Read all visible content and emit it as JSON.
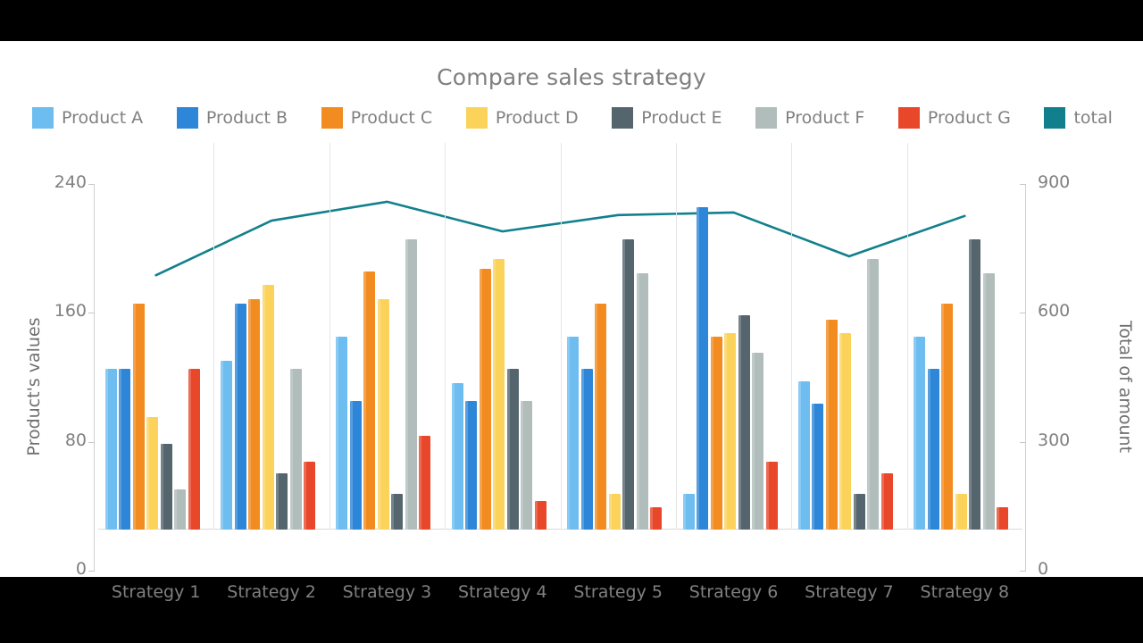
{
  "chart_data": {
    "type": "bar",
    "title": "Compare sales strategy",
    "xlabel": "",
    "ylabel": "Product's values",
    "y2label": "Total of amount",
    "categories": [
      "Strategy 1",
      "Strategy 2",
      "Strategy 3",
      "Strategy 4",
      "Strategy 5",
      "Strategy 6",
      "Strategy 7",
      "Strategy 8"
    ],
    "ylim": [
      0,
      240
    ],
    "yticks": [
      0,
      80,
      160,
      240
    ],
    "y2lim": [
      0,
      900
    ],
    "y2ticks": [
      0,
      300,
      600,
      900
    ],
    "grid": true,
    "legend_position": "top",
    "series": [
      {
        "name": "Product A",
        "type": "bar",
        "axis": "left",
        "color": "#6DBDF0",
        "values": [
          100,
          105,
          120,
          91,
          120,
          22,
          92,
          120
        ]
      },
      {
        "name": "Product B",
        "type": "bar",
        "axis": "left",
        "color": "#2E86D8",
        "values": [
          100,
          140,
          80,
          80,
          100,
          200,
          78,
          100
        ]
      },
      {
        "name": "Product C",
        "type": "bar",
        "axis": "left",
        "color": "#F28B20",
        "values": [
          140,
          143,
          160,
          162,
          140,
          120,
          130,
          140
        ]
      },
      {
        "name": "Product D",
        "type": "bar",
        "axis": "left",
        "color": "#FBD35B",
        "values": [
          70,
          152,
          143,
          168,
          22,
          122,
          122,
          22
        ]
      },
      {
        "name": "Product E",
        "type": "bar",
        "axis": "left",
        "color": "#55656E",
        "values": [
          53,
          35,
          22,
          100,
          180,
          133,
          22,
          180
        ]
      },
      {
        "name": "Product F",
        "type": "bar",
        "axis": "left",
        "color": "#B0BDBB",
        "values": [
          25,
          100,
          180,
          80,
          159,
          110,
          168,
          159
        ]
      },
      {
        "name": "Product G",
        "type": "bar",
        "axis": "left",
        "color": "#E8472A",
        "values": [
          100,
          42,
          58,
          18,
          14,
          42,
          35,
          14
        ]
      },
      {
        "name": "total",
        "type": "line",
        "axis": "right",
        "color": "#12808C",
        "values": [
          592,
          719,
          763,
          694,
          732,
          738,
          636,
          730
        ]
      }
    ]
  },
  "legend": {
    "items": [
      {
        "label": "Product A",
        "color": "#6DBDF0"
      },
      {
        "label": "Product B",
        "color": "#2E86D8"
      },
      {
        "label": "Product C",
        "color": "#F28B20"
      },
      {
        "label": "Product D",
        "color": "#FBD35B"
      },
      {
        "label": "Product E",
        "color": "#55656E"
      },
      {
        "label": "Product F",
        "color": "#B0BDBB"
      },
      {
        "label": "Product G",
        "color": "#E8472A"
      },
      {
        "label": "total",
        "color": "#12808C"
      }
    ]
  },
  "theme": {
    "background": "#ffffff",
    "letterbox": "#000000",
    "text": "#808080",
    "grid": "#e6e6e6",
    "axis": "#d0d0d0"
  }
}
